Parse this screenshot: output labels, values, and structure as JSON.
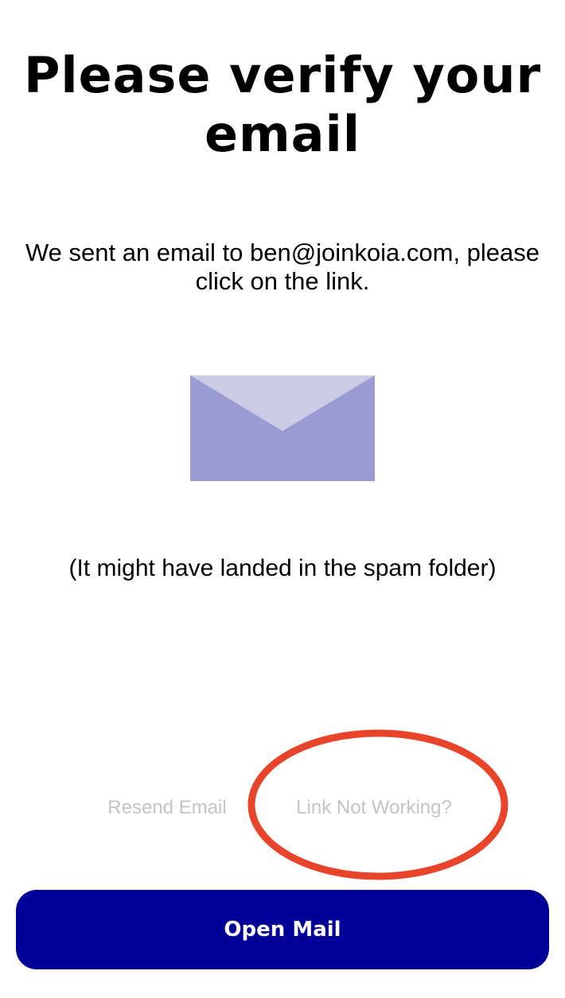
{
  "header": {
    "title": "Please verify your email"
  },
  "message": {
    "sent_text": "We sent an email to ben@joinkoia.com, please click on the link.",
    "spam_note": "(It might have landed in the spam folder)"
  },
  "illustration": {
    "icon": "envelope-icon",
    "body_color": "#9b9bd3",
    "flap_color": "#cbcbe6"
  },
  "actions": {
    "resend_label": "Resend Email",
    "link_not_working_label": "Link Not Working?",
    "open_mail_label": "Open Mail"
  },
  "colors": {
    "primary": "#000099",
    "secondary_text": "#c4c4c4",
    "annotation": "#e8442a"
  }
}
